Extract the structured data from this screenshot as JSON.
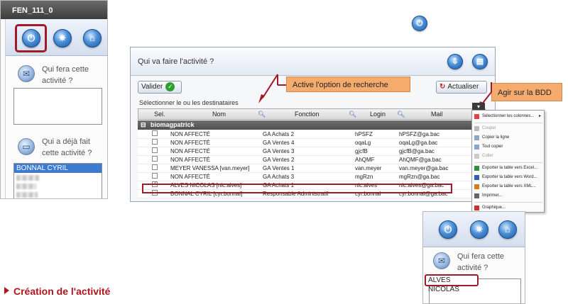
{
  "left_panel": {
    "title": "FEN_111_0",
    "qui_fera": "Qui fera cette activité ?",
    "qui_deja": "Qui a déjà fait cette activité ?",
    "list_selected": "BONNAL CYRIL"
  },
  "dialog": {
    "title": "Qui va faire l'activité ?",
    "valider_label": "Valider",
    "actualiser_label": "Actualiser",
    "instruction": "Sélectionner le ou les destinataires",
    "columns": {
      "sel": "Sel.",
      "nom": "Nom",
      "fonction": "Fonction",
      "login": "Login",
      "mail": "Mail"
    },
    "group_name": "biomagpatrick",
    "rows": [
      {
        "nom": "NON AFFECTÉ",
        "fonction": "GA Achats 2",
        "login": "hPSFZ",
        "mail": "hPSFZ@ga.bac",
        "checked": ""
      },
      {
        "nom": "NON AFFECTÉ",
        "fonction": "GA Ventes 4",
        "login": "oqaLg",
        "mail": "oqaLg@ga.bac",
        "checked": ""
      },
      {
        "nom": "NON AFFECTÉ",
        "fonction": "GA Ventes 3",
        "login": "gjcfB",
        "mail": "gjcfB@ga.bac",
        "checked": ""
      },
      {
        "nom": "NON AFFECTÉ",
        "fonction": "GA Ventes 2",
        "login": "AhQMF",
        "mail": "AhQMF@ga.bac",
        "checked": ""
      },
      {
        "nom": "MEYER VANESSA [van.meyer]",
        "fonction": "GA Ventes 1",
        "login": "van.meyer",
        "mail": "van.meyer@ga.bac",
        "checked": ""
      },
      {
        "nom": "NON AFFECTÉ",
        "fonction": "GA Achats 3",
        "login": "mgRzn",
        "mail": "mgRzn@ga.bac",
        "checked": ""
      },
      {
        "nom": "ALVES NICOLAS [nic.alves]",
        "fonction": "GA Achats 1",
        "login": "nic.alves",
        "mail": "nic.alves@ga.bac",
        "checked": "✓"
      },
      {
        "nom": "BONNAL CYRIL [cyr.bonnal]",
        "fonction": "Responsable Administratif",
        "login": "cyr.bonnal",
        "mail": "cyr.bonnal@ga.bac",
        "checked": ""
      }
    ]
  },
  "callouts": {
    "search": "Active l'option de recherche",
    "bdd": "Agir sur la BDD"
  },
  "context_menu": {
    "items": [
      "Sélectionner les colonnes...",
      "Couper",
      "Copier la ligne",
      "Tout copier",
      "Coller",
      "Exporter la table vers Excel...",
      "Exporter la table vers Word...",
      "Exporter la table vers XML...",
      "Imprimer...",
      "Graphique..."
    ],
    "submenu_arrow": "▸"
  },
  "right_panel": {
    "qui_fera": "Qui fera cette activité ?",
    "selected": "ALVES NICOLAS"
  },
  "section": {
    "title": "Création de l'activité"
  },
  "icons": {
    "toolbar_buttons": [
      "power-icon",
      "gear-icon",
      "basket-icon"
    ],
    "envelope": "envelope-icon",
    "folder": "folder-icon"
  },
  "colors": {
    "accent_red": "#a11a28",
    "callout_orange": "#f6ab6e",
    "selection_blue": "#3d7bd1"
  }
}
